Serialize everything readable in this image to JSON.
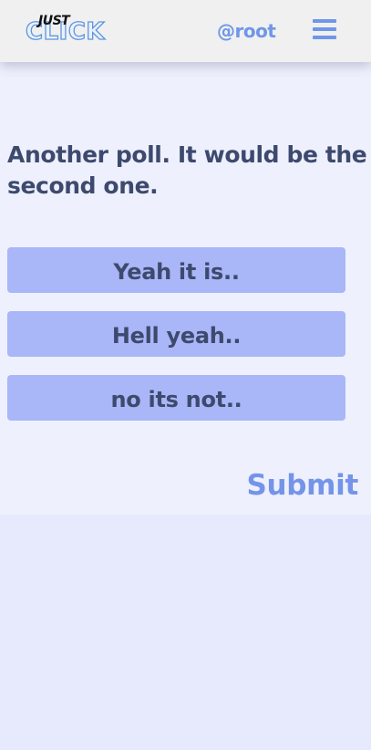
{
  "header": {
    "logo_top": "JUST",
    "logo_main": "CLICK",
    "username": "@root",
    "menu_icon": "hamburger-menu-icon"
  },
  "poll": {
    "question": "Another poll. It would be the second one.",
    "options": [
      {
        "label": "Yeah it is.."
      },
      {
        "label": "Hell yeah.."
      },
      {
        "label": "no its not.."
      }
    ],
    "submit_label": "Submit"
  },
  "colors": {
    "header_bg": "#f0f0f0",
    "page_bg": "#e6eafc",
    "content_bg": "#eef0fd",
    "accent": "#6f96e8",
    "option_bg": "#a9b6f7",
    "text": "#3d4a6e"
  }
}
